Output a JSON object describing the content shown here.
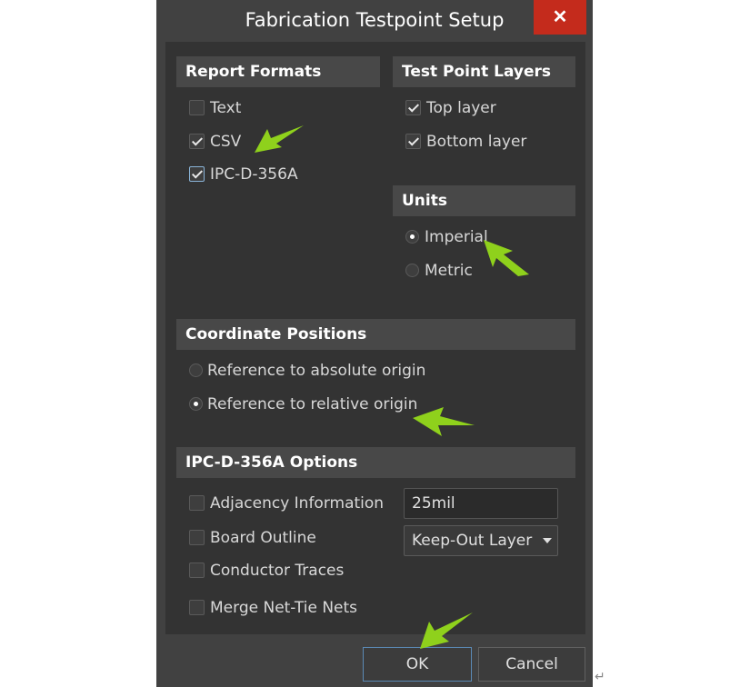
{
  "window": {
    "title": "Fabrication Testpoint Setup",
    "close_glyph": "✕"
  },
  "report_formats": {
    "heading": "Report Formats",
    "options": [
      {
        "label": "Text",
        "checked": false
      },
      {
        "label": "CSV",
        "checked": true
      },
      {
        "label": "IPC-D-356A",
        "checked": true
      }
    ]
  },
  "test_point_layers": {
    "heading": "Test Point Layers",
    "options": [
      {
        "label": "Top layer",
        "checked": true
      },
      {
        "label": "Bottom layer",
        "checked": true
      }
    ]
  },
  "units": {
    "heading": "Units",
    "options": [
      {
        "label": "Imperial",
        "selected": true
      },
      {
        "label": "Metric",
        "selected": false
      }
    ]
  },
  "coordinate_positions": {
    "heading": "Coordinate Positions",
    "options": [
      {
        "label": "Reference to absolute origin",
        "selected": false
      },
      {
        "label": "Reference to relative origin",
        "selected": true
      }
    ]
  },
  "ipc_options": {
    "heading": "IPC-D-356A Options",
    "options": [
      {
        "label": "Adjacency Information",
        "checked": false
      },
      {
        "label": "Board Outline",
        "checked": false
      },
      {
        "label": "Conductor Traces",
        "checked": false
      },
      {
        "label": "Merge Net-Tie Nets",
        "checked": false
      }
    ],
    "adjacency_value": "25mil",
    "board_outline_layer": "Keep-Out Layer"
  },
  "buttons": {
    "ok": "OK",
    "cancel": "Cancel"
  },
  "annotation_color": "#8fd11c"
}
